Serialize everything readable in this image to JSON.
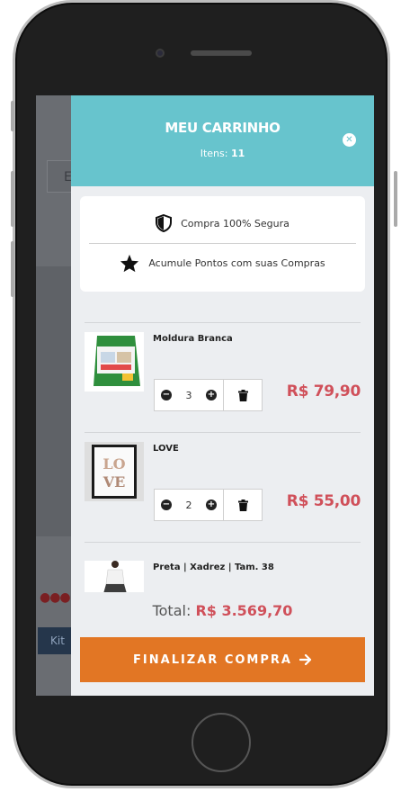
{
  "cart": {
    "title": "MEU CARRINHO",
    "items_label": "Itens:",
    "items_count": "11",
    "close_icon": "close-icon"
  },
  "trust": {
    "secure": "Compra 100% Segura",
    "points": "Acumule Pontos com suas Compras"
  },
  "products": [
    {
      "name": "Moldura Branca",
      "quantity": "3",
      "price": "R$ 79,90"
    },
    {
      "name": "LOVE",
      "quantity": "2",
      "price": "R$ 55,00"
    },
    {
      "name": "Preta | Xadrez | Tam. 38"
    }
  ],
  "total": {
    "label": "Total:",
    "value": "R$ 3.569,70"
  },
  "checkout": {
    "label": "FINALIZAR COMPRA"
  },
  "background": {
    "field_text": "E",
    "kit_label": "Kit"
  },
  "colors": {
    "header": "#67c4cd",
    "price": "#d0505a",
    "checkout": "#e27624"
  }
}
